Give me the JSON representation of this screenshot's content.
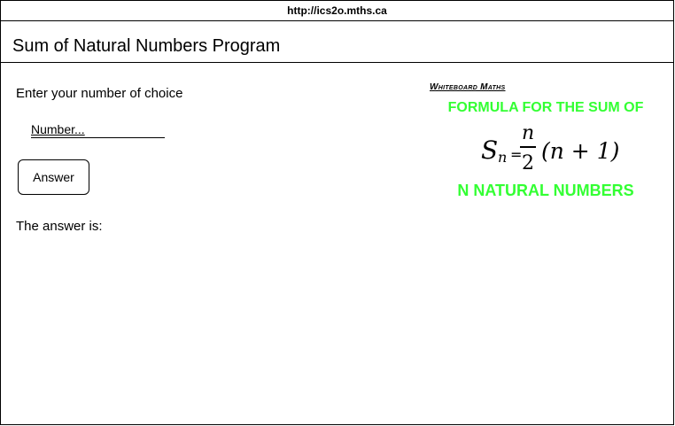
{
  "browser": {
    "url": "http://ics2o.mths.ca"
  },
  "page": {
    "title": "Sum of Natural Numbers Program"
  },
  "form": {
    "prompt": "Enter your number of choice",
    "number_input": {
      "placeholder": "Number...",
      "value": ""
    },
    "answer_button_label": "Answer",
    "answer_label": "The answer is:"
  },
  "formula_image": {
    "logo_text": "Whiteboard Maths",
    "line1": "FORMULA FOR THE SUM OF",
    "line2": "N NATURAL NUMBERS",
    "formula": {
      "lhs_symbol": "S",
      "lhs_subscript": "n",
      "equals": "=",
      "numerator": "n",
      "denominator": "2",
      "rhs": "(n + 1)"
    },
    "accent_color": "#33ff33"
  }
}
